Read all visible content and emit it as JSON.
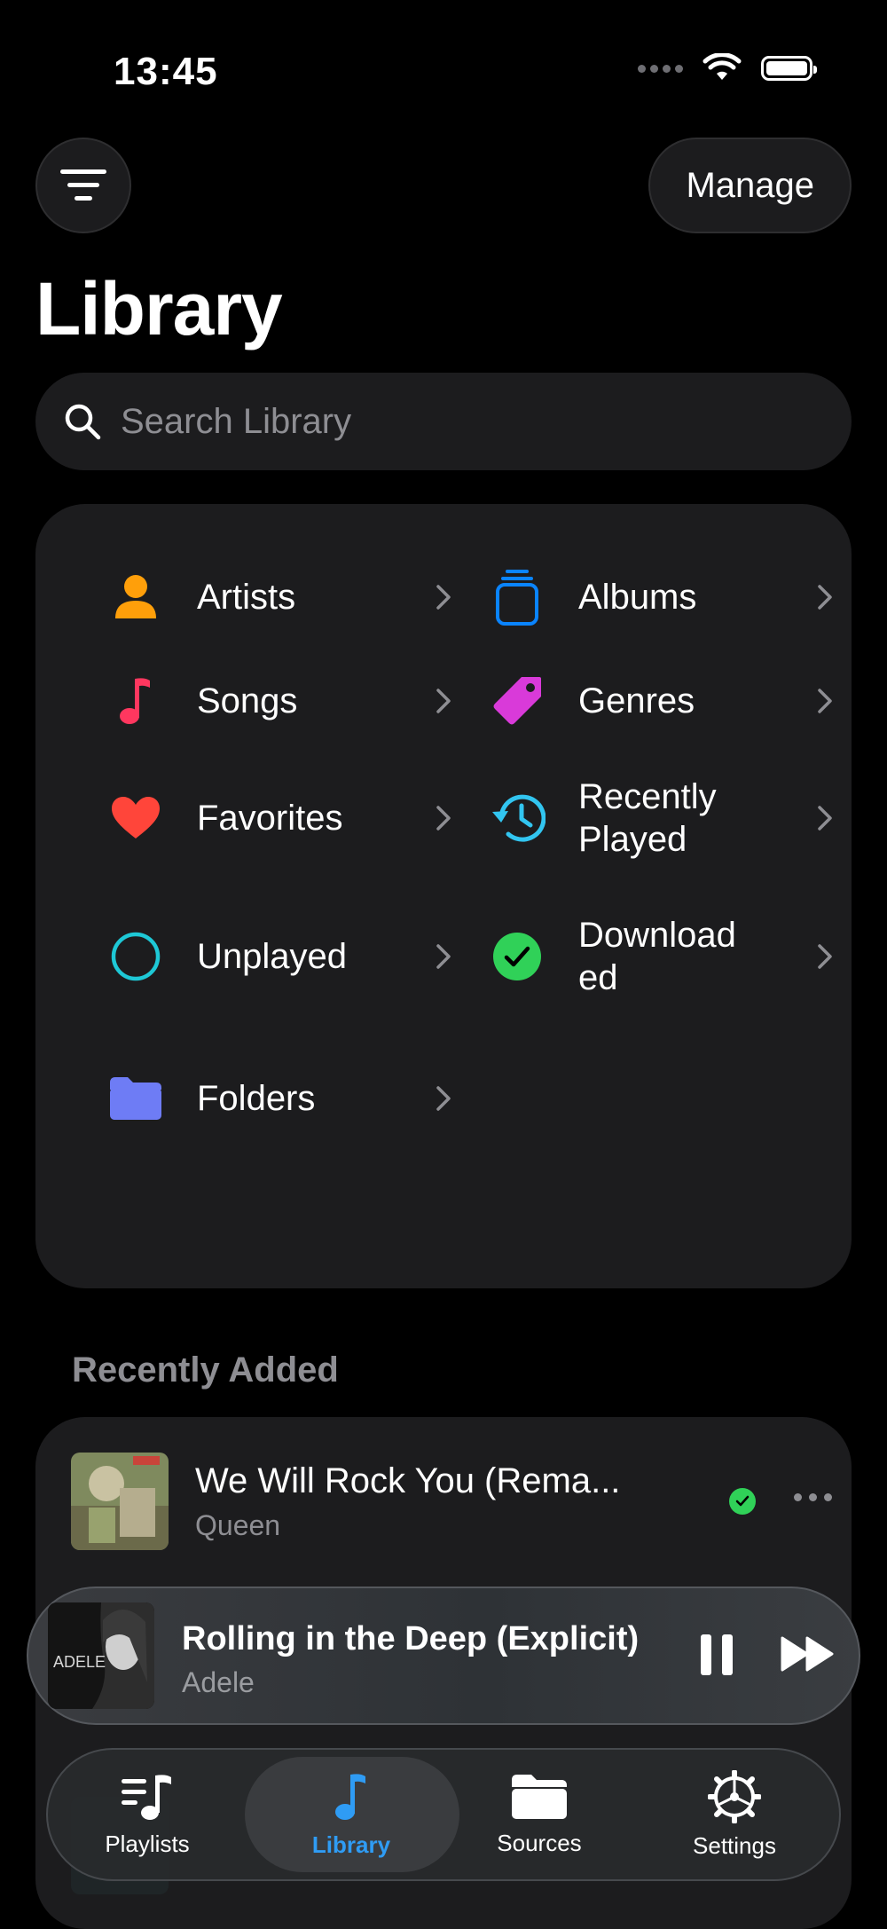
{
  "status_bar": {
    "time": "13:45"
  },
  "header": {
    "title": "Library",
    "manage_label": "Manage"
  },
  "search": {
    "placeholder": "Search Library"
  },
  "library_items": {
    "artists": "Artists",
    "albums": "Albums",
    "songs": "Songs",
    "genres": "Genres",
    "favorites": "Favorites",
    "recently_played": "Recently Played",
    "unplayed": "Unplayed",
    "downloaded": "Downloaded",
    "folders": "Folders"
  },
  "recently_added": {
    "title": "Recently Added",
    "items": [
      {
        "title": "We Will Rock You (Rema...",
        "artist": "Queen"
      }
    ]
  },
  "now_playing": {
    "title": "Rolling in the Deep (Explicit)",
    "artist": "Adele",
    "art_text": "ADELE"
  },
  "tabs": [
    {
      "label": "Playlists"
    },
    {
      "label": "Library"
    },
    {
      "label": "Sources"
    },
    {
      "label": "Settings"
    }
  ],
  "colors": {
    "accent": "#2f9cf4",
    "artists": "#ff9f0a",
    "albums": "#0a84ff",
    "songs": "#ff375f",
    "genres": "#d93ad9",
    "favorites": "#ff453a",
    "recently_played": "#32c5f0",
    "unplayed": "#1ec8d6",
    "downloaded": "#30d158",
    "folders": "#6e7cf5"
  }
}
